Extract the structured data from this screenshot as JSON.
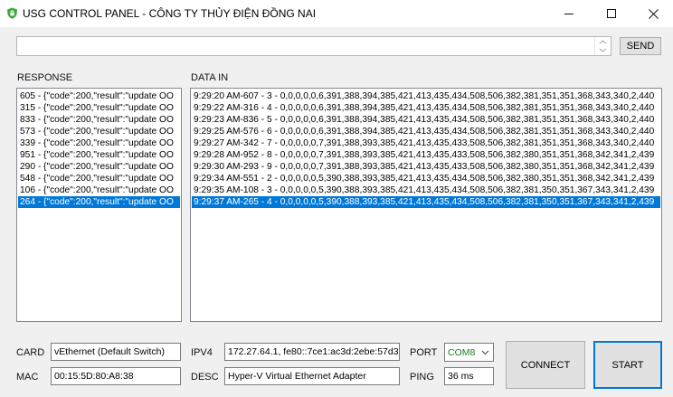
{
  "window": {
    "title": "USG CONTROL PANEL - CÔNG TY THỦY ĐIỆN ĐỒNG NAI",
    "icon": "shield-app-icon",
    "accent": "#3aa93a"
  },
  "command": {
    "value": "",
    "send_label": "SEND"
  },
  "response": {
    "label": "RESPONSE",
    "items": [
      "605 - {\"code\":200,\"result\":\"update OO",
      "315 - {\"code\":200,\"result\":\"update OO",
      "833 - {\"code\":200,\"result\":\"update OO",
      "573 - {\"code\":200,\"result\":\"update OO",
      "339 - {\"code\":200,\"result\":\"update OO",
      "951 - {\"code\":200,\"result\":\"update OO",
      "290 - {\"code\":200,\"result\":\"update OO",
      "548 - {\"code\":200,\"result\":\"update OO",
      "106 - {\"code\":200,\"result\":\"update OO",
      "264 - {\"code\":200,\"result\":\"update OO"
    ],
    "selected_index": 9
  },
  "data_in": {
    "label": "DATA IN",
    "items": [
      "9:29:20 AM-607 - 3 - 0,0,0,0,0,6,391,388,394,385,421,413,435,434,508,506,382,381,351,351,368,343,340,2,440",
      "9:29:22 AM-316 - 4 - 0,0,0,0,0,6,391,388,394,385,421,413,435,434,508,506,382,381,351,351,368,343,340,2,440",
      "9:29:23 AM-836 - 5 - 0,0,0,0,0,6,391,388,394,385,421,413,435,434,508,506,382,381,351,351,368,343,340,2,440",
      "9:29:25 AM-576 - 6 - 0,0,0,0,0,6,391,388,394,385,421,413,435,434,508,506,382,381,351,351,368,343,340,2,440",
      "9:29:27 AM-342 - 7 - 0,0,0,0,0,7,391,388,393,385,421,413,435,433,508,506,382,381,351,351,368,343,340,2,440",
      "9:29:28 AM-952 - 8 - 0,0,0,0,0,7,391,388,393,385,421,413,435,433,508,506,382,380,351,351,368,342,341,2,439",
      "9:29:30 AM-293 - 9 - 0,0,0,0,0,7,391,388,393,385,421,413,435,433,508,506,382,380,351,351,368,342,341,2,439",
      "9:29:34 AM-551 - 2 - 0,0,0,0,0,5,390,388,393,385,421,413,435,434,508,506,382,380,351,351,368,342,341,2,439",
      "9:29:35 AM-108 - 3 - 0,0,0,0,0,5,390,388,393,385,421,413,435,434,508,506,382,381,350,351,367,343,341,2,439",
      "9:29:37 AM-265 - 4 - 0,0,0,0,0,5,390,388,393,385,421,413,435,434,508,506,382,381,350,351,367,343,341,2,439"
    ],
    "selected_index": 9
  },
  "form": {
    "card_label": "CARD",
    "card_value": "vEthernet (Default Switch)",
    "mac_label": "MAC",
    "mac_value": "00:15:5D:80:A8:38",
    "ipv4_label": "IPV4",
    "ipv4_value": "172.27.64.1, fe80::7ce1:ac3d:2ebe:57d3",
    "desc_label": "DESC",
    "desc_value": "Hyper-V Virtual Ethernet Adapter",
    "port_label": "PORT",
    "port_value": "COM8",
    "port_color": "#1a7f1a",
    "ping_label": "PING",
    "ping_value": "36 ms"
  },
  "buttons": {
    "connect_label": "CONNECT",
    "start_label": "START"
  }
}
